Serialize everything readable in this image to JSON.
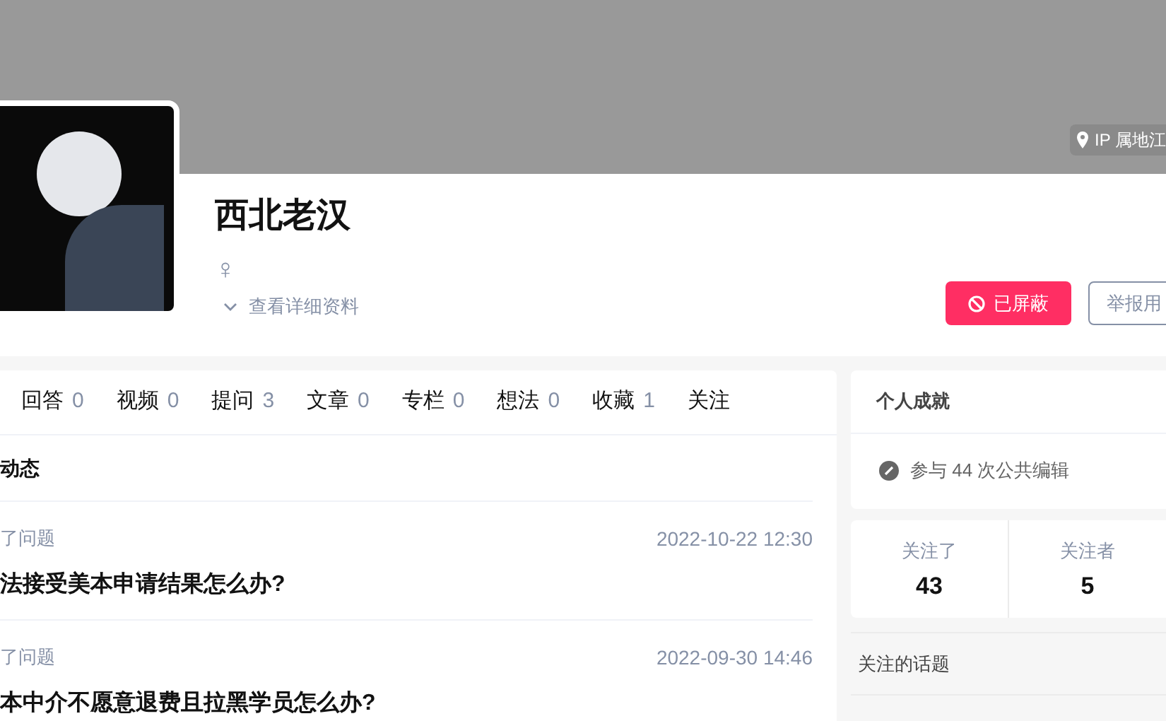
{
  "header": {
    "ip_location": "IP 属地江",
    "name": "西北老汉",
    "gender": "♀",
    "details_link": "查看详细资料",
    "buttons": [
      {
        "kind": "blocked",
        "label": "已屏蔽"
      },
      {
        "kind": "report",
        "label": "举报用"
      }
    ]
  },
  "tabs": [
    {
      "label": "回答",
      "count": "0"
    },
    {
      "label": "视频",
      "count": "0"
    },
    {
      "label": "提问",
      "count": "3"
    },
    {
      "label": "文章",
      "count": "0"
    },
    {
      "label": "专栏",
      "count": "0"
    },
    {
      "label": "想法",
      "count": "0"
    },
    {
      "label": "收藏",
      "count": "1"
    },
    {
      "label": "关注"
    }
  ],
  "feed": {
    "title": "动态",
    "items": [
      {
        "action": "了问题",
        "time": "2022-10-22 12:30",
        "title": "法接受美本申请结果怎么办?"
      },
      {
        "action": "了问题",
        "time": "2022-09-30 14:46",
        "title": "本中介不愿意退费且拉黑学员怎么办?"
      }
    ]
  },
  "sidebar": {
    "achievements_title": "个人成就",
    "achievement": "参与 44 次公共编辑",
    "stats": [
      {
        "label": "关注了",
        "value": "43"
      },
      {
        "label": "关注者",
        "value": "5"
      }
    ],
    "links": [
      "关注的话题"
    ]
  }
}
